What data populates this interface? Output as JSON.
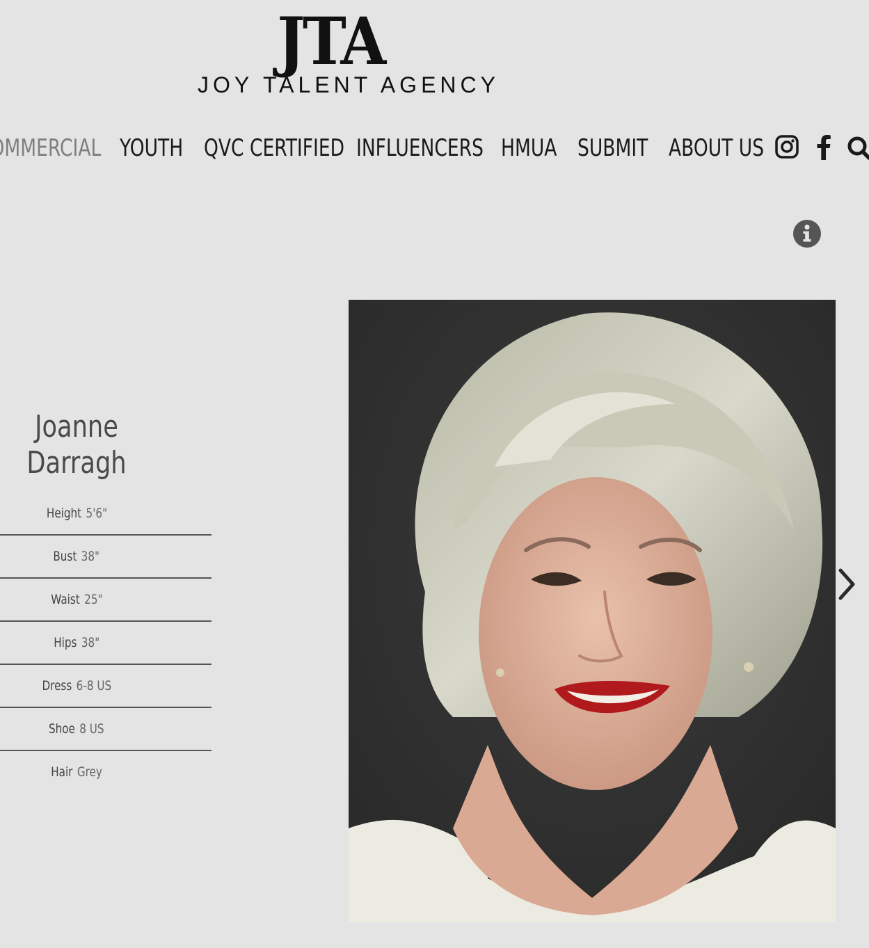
{
  "brand": {
    "mark": "JTA",
    "name": "JOY TALENT AGENCY"
  },
  "nav": {
    "items": [
      {
        "label": "COMMERCIAL",
        "active": true
      },
      {
        "label": "YOUTH"
      },
      {
        "label": "QVC CERTIFIED"
      },
      {
        "label": "INFLUENCERS"
      },
      {
        "label": "HMUA"
      },
      {
        "label": "SUBMIT"
      },
      {
        "label": "ABOUT US"
      }
    ],
    "icons": [
      "instagram-icon",
      "facebook-icon",
      "search-icon"
    ]
  },
  "profile": {
    "first_name": "Joanne",
    "last_name": "Darragh",
    "stats": [
      {
        "label": "Height",
        "value": "5'6\""
      },
      {
        "label": "Bust",
        "value": "38\""
      },
      {
        "label": "Waist",
        "value": "25\""
      },
      {
        "label": "Hips",
        "value": "38\""
      },
      {
        "label": "Dress",
        "value": "6-8 US"
      },
      {
        "label": "Shoe",
        "value": "8 US"
      },
      {
        "label": "Hair",
        "value": "Grey"
      }
    ]
  },
  "gallery": {
    "controls": [
      "info-icon",
      "next-arrow-icon"
    ]
  },
  "colors": {
    "background": "#e4e4e4",
    "text": "#1a1a1a",
    "muted": "#7f7f7f",
    "photo_bg": "#2d2e2d"
  }
}
